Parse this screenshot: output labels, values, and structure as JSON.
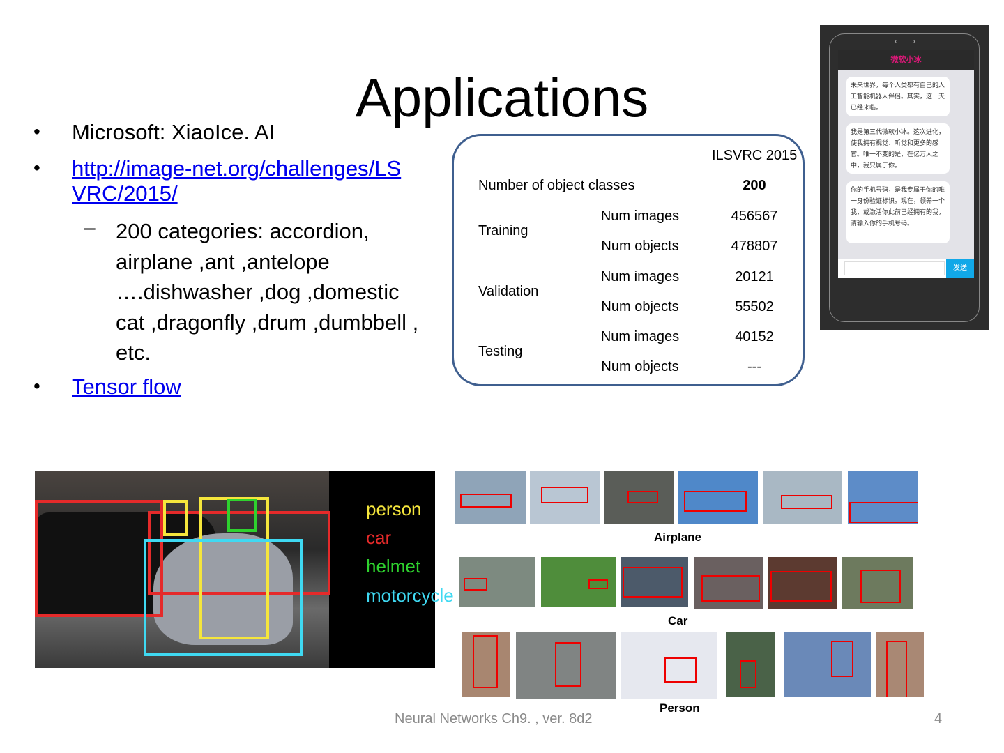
{
  "title": "Applications",
  "bullets": [
    {
      "text": "Microsoft: XiaoIce. AI"
    },
    {
      "text": "http://image-net.org/challenges/LSVRC/2015/",
      "line1": "http://image-net.org/challenges/LS",
      "line2": "VRC/2015/"
    },
    {
      "sub": [
        "200 categories: accordion,",
        "airplane ,ant ,antelope",
        "….dishwasher ,dog ,domestic",
        "cat ,dragonfly ,drum ,dumbbell ,",
        "etc."
      ]
    },
    {
      "text": "Tensor flow"
    }
  ],
  "table": {
    "header": "ILSVRC 2015",
    "classes_label": "Number of object classes",
    "classes_value": "200",
    "rows": [
      {
        "group": "Training",
        "items": [
          {
            "label": "Num images",
            "value": "456567"
          },
          {
            "label": "Num objects",
            "value": "478807"
          }
        ]
      },
      {
        "group": "Validation",
        "items": [
          {
            "label": "Num images",
            "value": "20121"
          },
          {
            "label": "Num objects",
            "value": "55502"
          }
        ]
      },
      {
        "group": "Testing",
        "items": [
          {
            "label": "Num images",
            "value": "40152"
          },
          {
            "label": "Num objects",
            "value": "---"
          }
        ]
      }
    ]
  },
  "phone": {
    "app_title": "微软小冰",
    "messages": [
      "未来世界，每个人类都有自己的人工智能机器人伴侣。其实，这一天已经来临。",
      "我是第三代微软小冰。这次进化，使我拥有视觉、听觉和更多的感官。唯一不变的是，在亿万人之中，我只属于你。",
      "你的手机号码，是我专属于你的唯一身份验证标识。现在，领养一个我，或激活你此前已经拥有的我，请输入你的手机号码。"
    ],
    "send_label": "发送"
  },
  "detection_labels": [
    {
      "text": "person",
      "color": "#f5e63c"
    },
    {
      "text": "car",
      "color": "#e52a2a"
    },
    {
      "text": "helmet",
      "color": "#2ed12e"
    },
    {
      "text": "motorcycle",
      "color": "#3fd9f2"
    }
  ],
  "captions": {
    "airplane": "Airplane",
    "car": "Car",
    "person": "Person"
  },
  "footer": {
    "text": "Neural Networks Ch9. , ver. 8d2",
    "page": "4"
  }
}
